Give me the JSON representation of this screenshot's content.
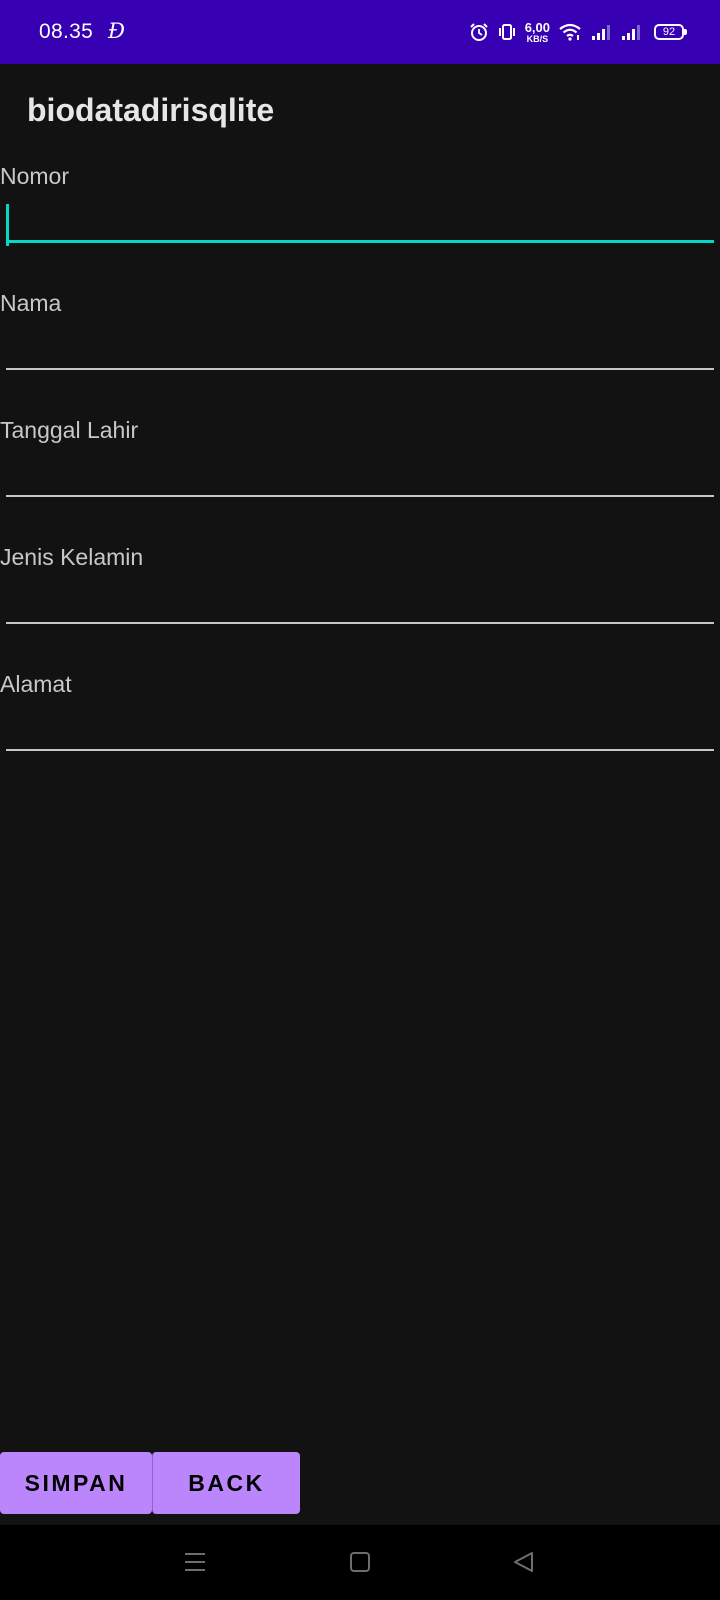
{
  "status_bar": {
    "time": "08.35",
    "notification_glyph": "Đ",
    "icons": [
      "alarm-icon",
      "vibrate-icon",
      "wifi-icon",
      "signal-icon",
      "signal-icon"
    ],
    "net_speed_value": "6,00",
    "net_speed_unit": "KB/S",
    "battery_level": "92",
    "background_color": "#3700b3"
  },
  "app": {
    "title": "biodatadirisqlite",
    "background_color": "#121212",
    "accent_color": "#03dac5"
  },
  "form": {
    "fields": [
      {
        "label": "Nomor",
        "value": "",
        "focused": true
      },
      {
        "label": "Nama",
        "value": ""
      },
      {
        "label": "Tanggal Lahir",
        "value": ""
      },
      {
        "label": "Jenis Kelamin",
        "value": ""
      },
      {
        "label": "Alamat",
        "value": ""
      }
    ]
  },
  "buttons": {
    "save_label": "SIMPAN",
    "back_label": "BACK",
    "color": "#bb86fc"
  },
  "nav_bar": {
    "icons": [
      "menu-icon",
      "home-icon",
      "back-icon"
    ]
  }
}
